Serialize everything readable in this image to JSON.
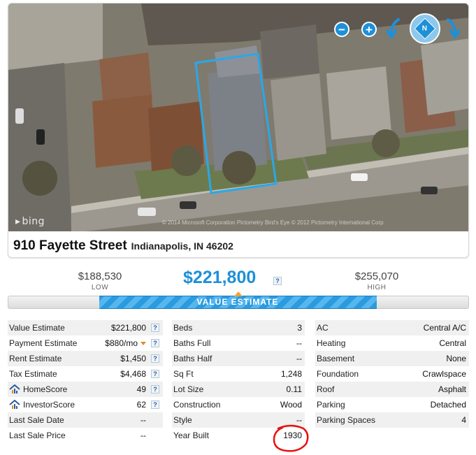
{
  "property": {
    "street": "910 Fayette Street",
    "city_state_zip": "Indianapolis, IN 46202"
  },
  "map": {
    "logo": "bing",
    "copyright": "© 2014 Microsoft Corporation  Pictometry Bird's Eye © 2012 Pictometry International Corp",
    "controls": {
      "zoom_out": "−",
      "zoom_in": "+",
      "compass": "N",
      "rotate_left_icon": "rotate-left-arrow-icon",
      "rotate_right_icon": "rotate-right-arrow-icon"
    },
    "colors": {
      "control": "#1e90d8",
      "parcel_outline": "#29a8e8"
    }
  },
  "estimate": {
    "low_value": "$188,530",
    "low_label": "LOW",
    "value": "$221,800",
    "high_value": "$255,070",
    "high_label": "HIGH",
    "bar_label": "VALUE ESTIMATE",
    "help": "?",
    "accent_color": "#1e90d8",
    "pointer_color": "#f0a23a"
  },
  "financial": [
    {
      "label": "Value Estimate",
      "value": "$221,800",
      "help": "?"
    },
    {
      "label": "Payment Estimate",
      "value": "$880/mo",
      "help": "?"
    },
    {
      "label": "Rent Estimate",
      "value": "$1,450",
      "help": "?"
    },
    {
      "label": "Tax Estimate",
      "value": "$4,468",
      "help": "?"
    },
    {
      "label": "HomeScore",
      "value": "49",
      "help": "?"
    },
    {
      "label": "InvestorScore",
      "value": "62",
      "help": "?"
    },
    {
      "label": "Last Sale Date",
      "value": "--"
    },
    {
      "label": "Last Sale Price",
      "value": "--"
    }
  ],
  "structure": [
    {
      "label": "Beds",
      "value": "3"
    },
    {
      "label": "Baths Full",
      "value": "--"
    },
    {
      "label": "Baths Half",
      "value": "--"
    },
    {
      "label": "Sq Ft",
      "value": "1,248"
    },
    {
      "label": "Lot Size",
      "value": "0.11"
    },
    {
      "label": "Construction",
      "value": "Wood"
    },
    {
      "label": "Style",
      "value": "--"
    },
    {
      "label": "Year Built",
      "value": "1930"
    }
  ],
  "features": [
    {
      "label": "AC",
      "value": "Central A/C"
    },
    {
      "label": "Heating",
      "value": "Central"
    },
    {
      "label": "Basement",
      "value": "None"
    },
    {
      "label": "Foundation",
      "value": "Crawlspace"
    },
    {
      "label": "Roof",
      "value": "Asphalt"
    },
    {
      "label": "Parking",
      "value": "Detached"
    },
    {
      "label": "Parking Spaces",
      "value": "4"
    }
  ],
  "annotation": {
    "circle_color": "#e81010"
  }
}
